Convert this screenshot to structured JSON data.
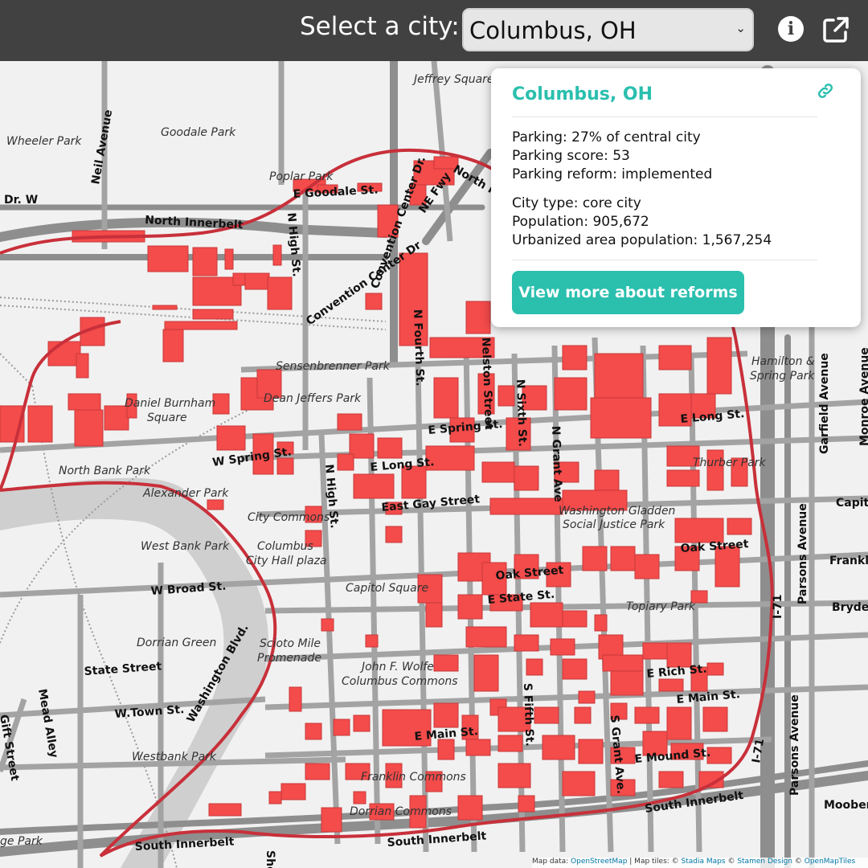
{
  "header": {
    "select_label": "Select a city:",
    "selected_city": "Columbus, OH",
    "chevron": "⌄",
    "info_icon": "info-icon",
    "share_icon": "external-link-icon"
  },
  "popup": {
    "title": "Columbus, OH",
    "link_icon": "link-icon",
    "parking": "Parking: 27% of central city",
    "parking_score": "Parking score: 53",
    "parking_reform": "Parking reform: implemented",
    "city_type": "City type: core city",
    "population": "Population: 905,672",
    "urbanized": "Urbanized area population: 1,567,254",
    "button": "View more about reforms"
  },
  "map": {
    "colors": {
      "parking": "#f44b4b",
      "boundary": "#c8303a",
      "river": "#cfcfcf",
      "road": "#8e8e8e",
      "teal": "#2bbfae"
    },
    "place_labels": {
      "jeffrey": "Jeffrey Square",
      "goodale": "Goodale Park",
      "wheeler": "Wheeler Park",
      "poplar": "Poplar Park",
      "sensenbrenner": "Sensenbrenner Park",
      "burnham1": "Daniel Burnham",
      "burnham2": "Square",
      "dean": "Dean Jeffers Park",
      "northbank": "North Bank Park",
      "alexander": "Alexander Park",
      "citycommons": "City Commons",
      "westbank": "West Bank Park",
      "cityhall1": "Columbus",
      "cityhall2": "City Hall plaza",
      "capitol": "Capitol Square",
      "dorrian": "Dorrian Green",
      "scioto1": "Scioto Mile",
      "scioto2": "Promenade",
      "wolfe1": "John F. Wolfe",
      "wolfe2": "Columbus Commons",
      "westbankp": "Westbank Park",
      "franklin": "Franklin Commons",
      "dorriancommons": "Dorrian Commons",
      "hamilton1": "Hamilton &",
      "hamilton2": "Spring Park",
      "thurber": "Thurber Park",
      "gladden1": "Washington Gladden",
      "gladden2": "Social Justice Park",
      "topiary": "Topiary Park",
      "gepark": "ge Park"
    },
    "road_labels": {
      "neil": "Neil Avenue",
      "drw": "Dr. W",
      "ninnerbelt": "North Innerbelt",
      "egoodale": "E Goodale St.",
      "nhigh1": "N High St.",
      "nefwy": "NE Fwy",
      "convdr": "Convention Center Dr.",
      "nfourth": "N Fourth St.",
      "conv": "Convention Center Dr",
      "nelston": "Nelston Street",
      "nsixth": "N Sixth St.",
      "ngrant": "N Grant Ave",
      "wspring": "W Spring St.",
      "espring": "E Spring St.",
      "elong1": "E Long St.",
      "elong2": "E Long St.",
      "nhigh2": "N High St.",
      "eastgay": "East Gay Street",
      "wbroad": "W Broad St.",
      "oak1": "Oak Street",
      "oak2": "Oak Street",
      "estate": "E State St.",
      "state": "State Street",
      "washblvd": "Washington Blvd.",
      "mead": "Mead Alley",
      "gift": "Gift Street",
      "wtown": "W.Town St.",
      "erich": "E Rich St.",
      "emain1": "E Main St.",
      "emain2": "E Main St.",
      "sfifth": "S Fifth St.",
      "sgrant": "S Grant Ave.",
      "emound": "E Mound St.",
      "sinnerbelt1": "South Innerbelt",
      "sinnerbelt2": "South Innerbelt",
      "sinnerbelt3": "South Innerbelt",
      "i71a": "I-71",
      "i71b": "I-71",
      "parsons1": "Parsons Avenue",
      "parsons2": "Parsons Avenue",
      "garfield": "Garfield Avenue",
      "monroe": "Monroe Avenue",
      "capita": "Capita",
      "franklin": "Franklin",
      "bryden": "Bryden",
      "moober": "Moober",
      "sho": "Sho",
      "northfwy": "North Fwy"
    }
  },
  "attribution": {
    "prefix": "Map data: ",
    "osm": "OpenStreetMap",
    "mid": " | Map tiles: © ",
    "stadia": "Stadia Maps",
    "sep1": " © ",
    "stamen": "Stamen Design",
    "sep2": " © ",
    "omt": "OpenMapTiles"
  }
}
